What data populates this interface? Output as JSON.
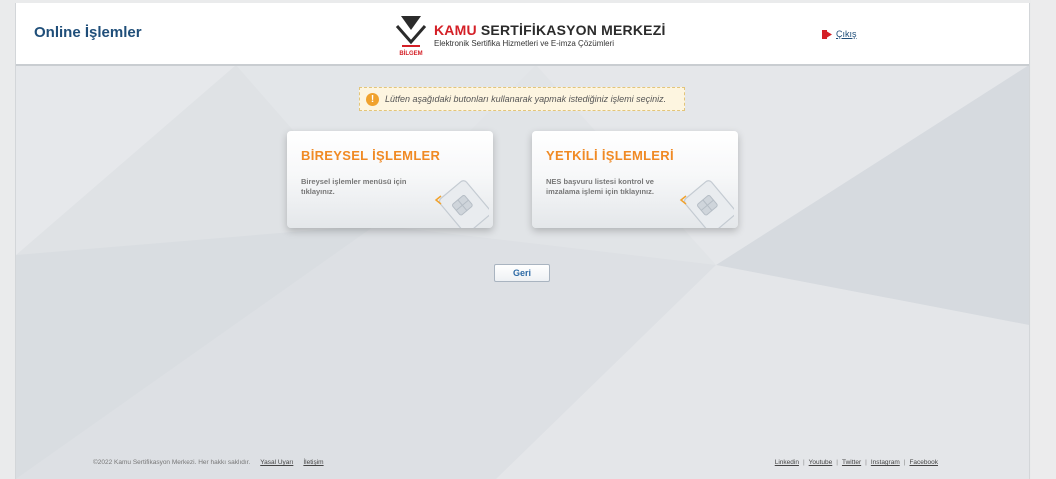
{
  "header": {
    "app_title": "Online İşlemler",
    "logo": {
      "brand_red": "KAMU",
      "brand_rest": " SERTİFİKASYON MERKEZİ",
      "subtitle": "Elektronik Sertifika Hizmetleri ve E-imza Çözümleri",
      "mark_text": "BİLGEM"
    },
    "logout_label": "Çıkış"
  },
  "notice": {
    "icon": "info-icon",
    "text": "Lütfen aşağıdaki butonları kullanarak yapmak istediğiniz işlemi seçiniz."
  },
  "cards": [
    {
      "title": "BİREYSEL İŞLEMLER",
      "description": "Bireysel işlemler menüsü için tıklayınız.",
      "icon": "smart-card-icon"
    },
    {
      "title": "YETKİLİ İŞLEMLERİ",
      "description": "NES başvuru listesi kontrol ve imzalama işlemi için tıklayınız.",
      "icon": "smart-card-icon"
    }
  ],
  "back_button": "Geri",
  "footer": {
    "copyright": "©2022 Kamu Sertifikasyon Merkezi. Her hakkı saklıdır.",
    "links_left": [
      "Yasal Uyarı",
      "İletişim"
    ],
    "social": [
      "Linkedin",
      "Youtube",
      "Twitter",
      "Instagram",
      "Facebook"
    ],
    "separator": "|"
  },
  "colors": {
    "title_blue": "#1f4e79",
    "accent_orange": "#f08a24",
    "brand_red": "#d41f26",
    "notice_bg": "#fdf5e0"
  }
}
